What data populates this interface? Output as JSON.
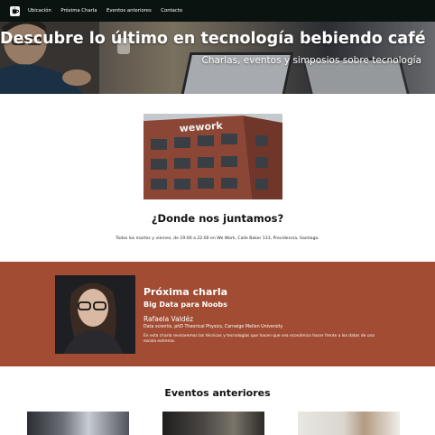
{
  "nav": {
    "logo_icon": "coffee-cup-icon",
    "links": [
      "Ubicación",
      "Próxima Charla",
      "Eventos anteriores",
      "Contacto"
    ]
  },
  "hero": {
    "title": "Descubre lo último en tecnología bebiendo café",
    "subtitle": "Charlas, eventos y simposios sobre tecnología"
  },
  "location": {
    "image_sign": "wework",
    "title": "¿Donde nos juntamos?",
    "text": "Todos los martes y viernes, de 19:00 a 22:00 en We Work, Calle Baker 133, Providencia, Santiago."
  },
  "next_talk": {
    "heading": "Próxima charla",
    "title": "Big Data para Noobs",
    "speaker_name": "Rafaela Valdéz",
    "speaker_role": "Data scientis, phD Theorical Physics, Carneige Mellon University",
    "description": "En esta charla revisaremos las técnicas y tecnologías que hacen que sea económico hacer frente a los datos de una escala extrema."
  },
  "past_events": {
    "title": "Eventos anteriores"
  },
  "colors": {
    "navbar_bg": "#0a130f",
    "next_talk_bg": "#a14c33"
  }
}
